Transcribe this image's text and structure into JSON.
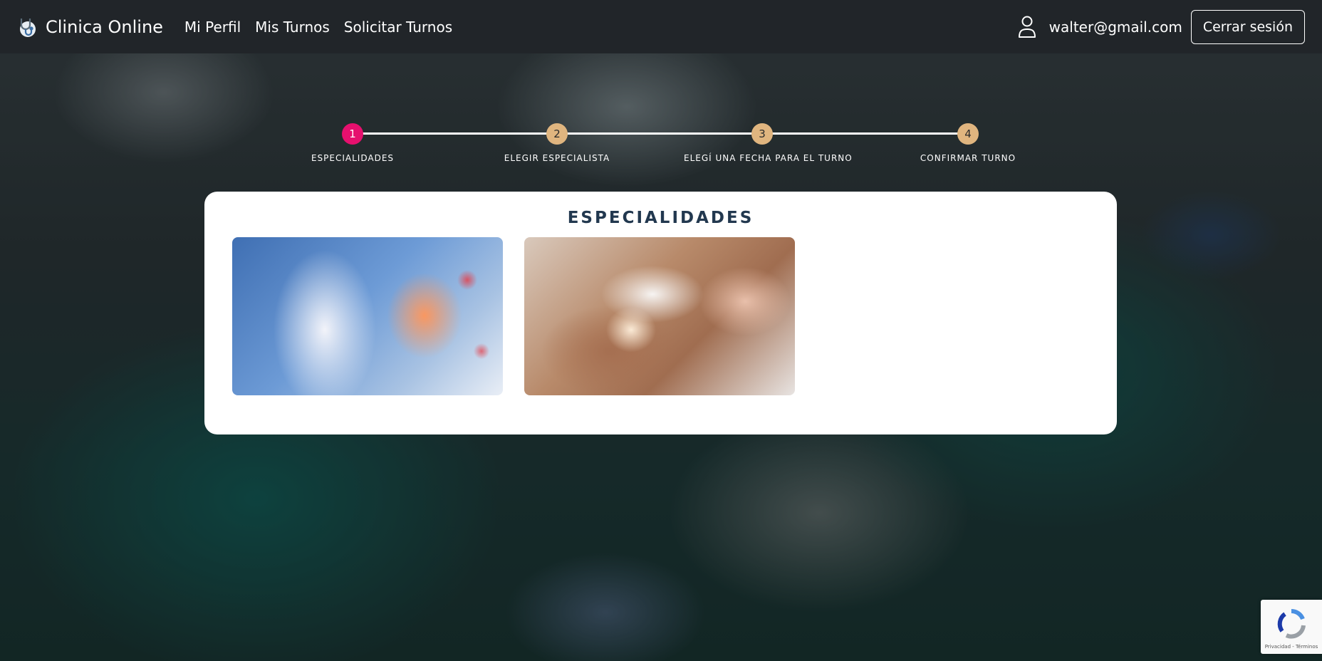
{
  "navbar": {
    "brand_icon": "stethoscope-icon",
    "brand": "Clinica Online",
    "links": [
      "Mi Perfil",
      "Mis Turnos",
      "Solicitar Turnos"
    ],
    "user_icon": "user-icon",
    "user_email": "walter@gmail.com",
    "logout_label": "Cerrar sesión"
  },
  "stepper": {
    "active_step": 1,
    "steps": [
      {
        "number": "1",
        "label": "ESPECIALIDADES"
      },
      {
        "number": "2",
        "label": "ELEGIR ESPECIALISTA"
      },
      {
        "number": "3",
        "label": "ELEGÍ UNA FECHA PARA EL TURNO"
      },
      {
        "number": "4",
        "label": "CONFIRMAR TURNO"
      }
    ]
  },
  "main": {
    "title": "ESPECIALIDADES",
    "specialties": [
      "gastroenterology-image",
      "dermatology-image"
    ]
  },
  "recaptcha": {
    "icon": "recaptcha-icon",
    "text": "Privacidad - Términos"
  },
  "colors": {
    "navbar_bg": "#212529",
    "step_active": "#e6106e",
    "step_inactive": "#e0b57f",
    "title": "#22384f"
  }
}
